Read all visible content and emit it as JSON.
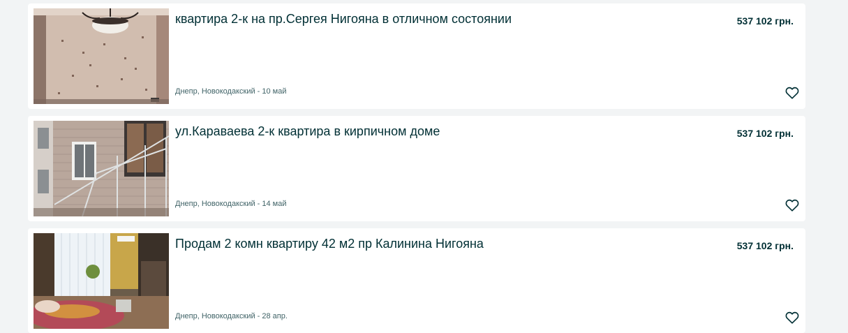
{
  "listings": [
    {
      "title": "квартира 2-к на пр.Сергея Нигояна в отличном состоянии",
      "price": "537 102 грн.",
      "location_date": "Днепр, Новокодакский - 10 май",
      "favorite_icon": "heart-outline-icon"
    },
    {
      "title": "ул.Караваева 2-к квартира в кирпичном доме",
      "price": "537 102 грн.",
      "location_date": "Днепр, Новокодакский - 14 май",
      "favorite_icon": "heart-outline-icon"
    },
    {
      "title": "Продам 2 комн квартиру 42 м2 пр Калинина Нигояна",
      "price": "537 102 грн.",
      "location_date": "Днепр, Новокодакский - 28 апр.",
      "favorite_icon": "heart-outline-icon"
    }
  ],
  "colors": {
    "page_background": "#f2f4f5",
    "card_background": "#ffffff",
    "text_primary": "#002f34",
    "text_secondary": "#406367"
  }
}
